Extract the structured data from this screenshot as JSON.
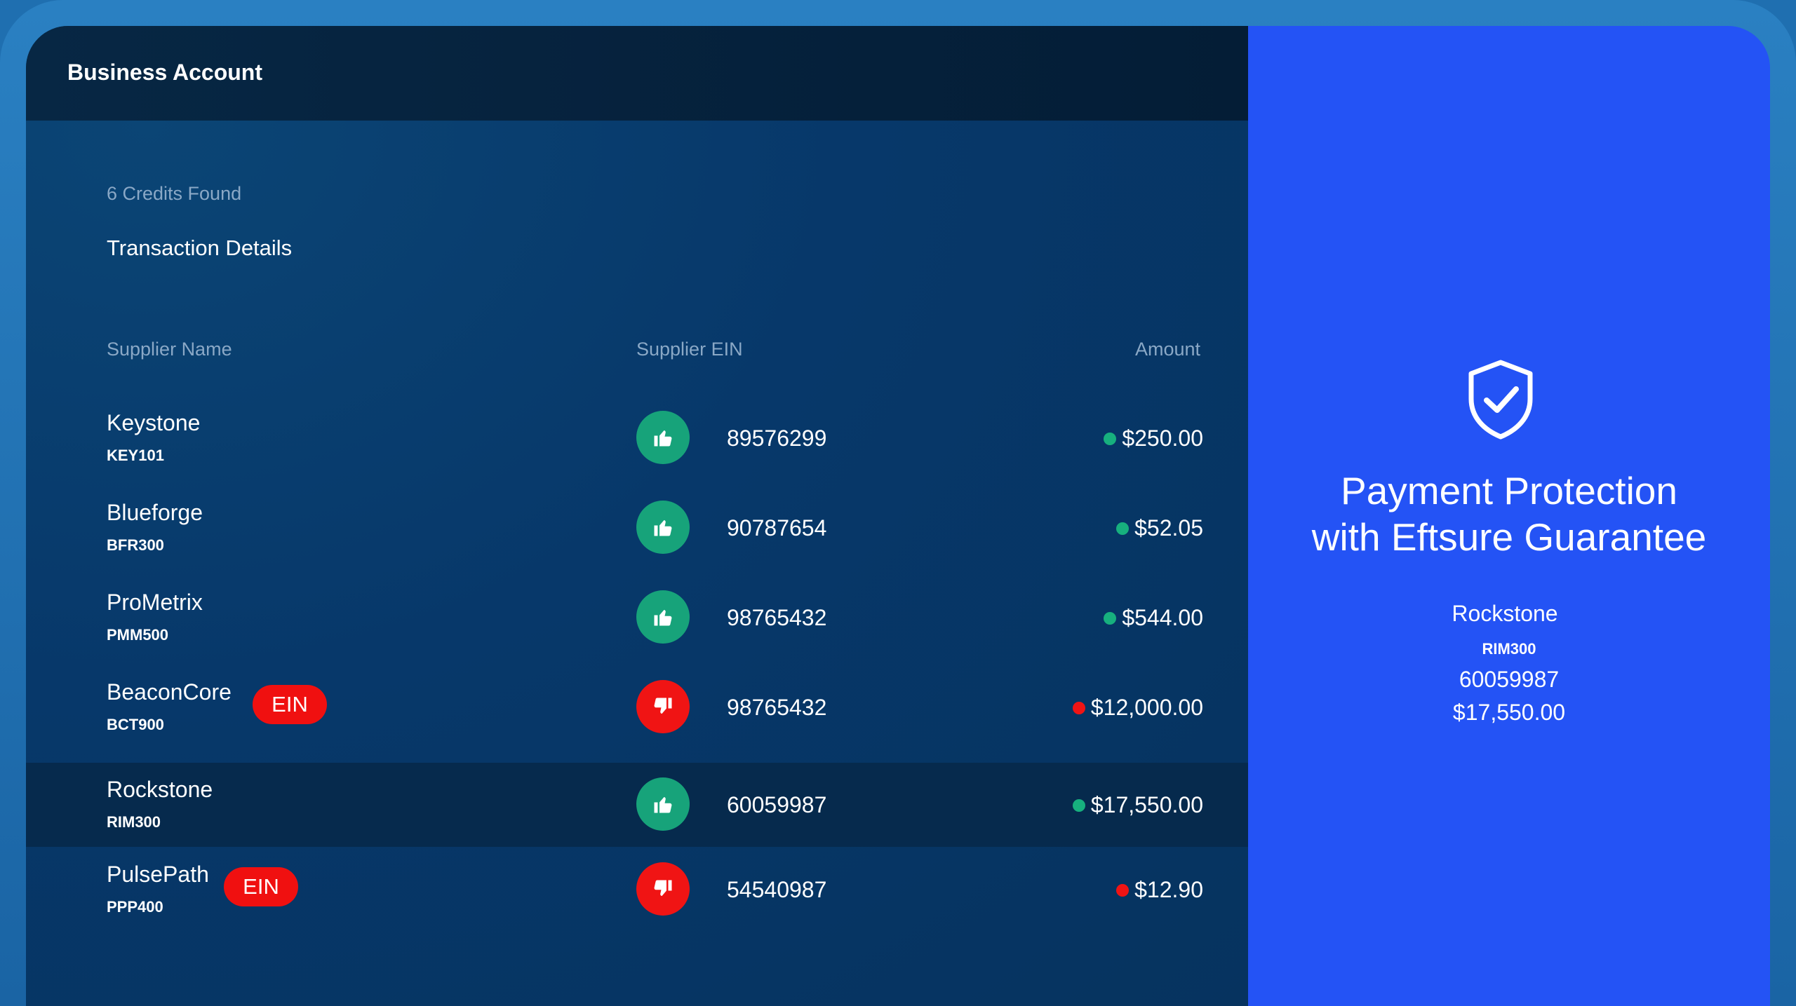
{
  "header": {
    "title": "Business Account"
  },
  "summary": {
    "credits_found": "6 Credits Found",
    "section_title": "Transaction Details"
  },
  "columns": {
    "supplier_name": "Supplier Name",
    "supplier_ein": "Supplier EIN",
    "amount": "Amount"
  },
  "rows": [
    {
      "name": "Keystone",
      "code": "KEY101",
      "ein": "89576299",
      "amount": "$250.00",
      "status": "good",
      "flag": ""
    },
    {
      "name": "Blueforge",
      "code": "BFR300",
      "ein": "90787654",
      "amount": "$52.05",
      "status": "good",
      "flag": ""
    },
    {
      "name": "ProMetrix",
      "code": "PMM500",
      "ein": "98765432",
      "amount": "$544.00",
      "status": "good",
      "flag": ""
    },
    {
      "name": "BeaconCore",
      "code": "BCT900",
      "ein": "98765432",
      "amount": "$12,000.00",
      "status": "bad",
      "flag": "EIN"
    },
    {
      "name": "Rockstone",
      "code": "RIM300",
      "ein": "60059987",
      "amount": "$17,550.00",
      "status": "good",
      "flag": ""
    },
    {
      "name": "PulsePath",
      "code": "PPP400",
      "ein": "54540987",
      "amount": "$12.90",
      "status": "bad",
      "flag": "EIN"
    }
  ],
  "promo": {
    "title_line1": "Payment Protection",
    "title_line2": "with Eftsure Guarantee",
    "name": "Rockstone",
    "code": "RIM300",
    "ein": "60059987",
    "amount": "$17,550.00"
  },
  "colors": {
    "good": "#17a37a",
    "bad": "#f01414",
    "panel_blue": "#2453f5",
    "navy": "#07386a"
  },
  "icons": {
    "good": "thumbs-up-icon",
    "bad": "thumbs-down-icon",
    "promo": "shield-check-icon"
  }
}
